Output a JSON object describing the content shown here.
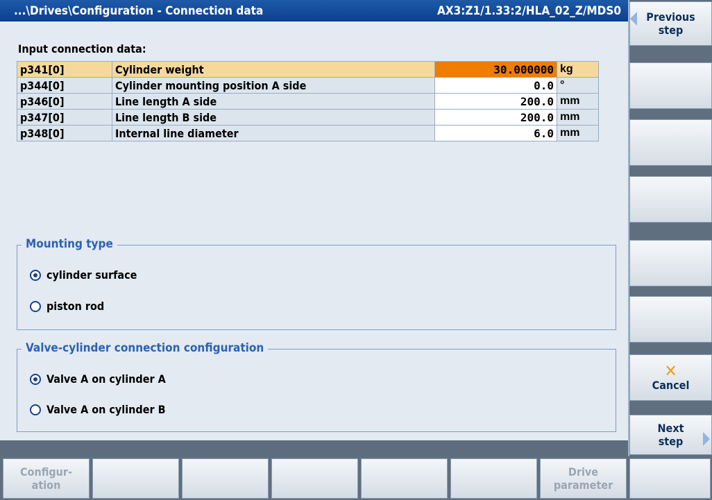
{
  "titlebar": {
    "path": "...\\Drives\\Configuration - Connection data",
    "axis": "AX3:Z1/1.33:2/HLA_02_Z/MDS0"
  },
  "section_label": "Input connection data:",
  "params": [
    {
      "id": "p341[0]",
      "desc": "Cylinder weight",
      "value": "30.000000",
      "unit": "kg",
      "selected": true
    },
    {
      "id": "p344[0]",
      "desc": "Cylinder mounting position A side",
      "value": "0.0",
      "unit": "°",
      "selected": false
    },
    {
      "id": "p346[0]",
      "desc": "Line length A side",
      "value": "200.0",
      "unit": "mm",
      "selected": false
    },
    {
      "id": "p347[0]",
      "desc": "Line length B side",
      "value": "200.0",
      "unit": "mm",
      "selected": false
    },
    {
      "id": "p348[0]",
      "desc": "Internal line diameter",
      "value": "6.0",
      "unit": "mm",
      "selected": false
    }
  ],
  "mounting_type": {
    "title": "Mounting type",
    "options": [
      {
        "label": "cylinder surface",
        "checked": true
      },
      {
        "label": "piston rod",
        "checked": false
      }
    ]
  },
  "valve_config": {
    "title": "Valve-cylinder connection configuration",
    "options": [
      {
        "label": "Valve A on cylinder A",
        "checked": true
      },
      {
        "label": "Valve A on cylinder B",
        "checked": false
      }
    ]
  },
  "vertical_softkeys": {
    "previous_step_line1": "Previous",
    "previous_step_line2": "step",
    "cancel": "Cancel",
    "next_step_line1": "Next",
    "next_step_line2": "step"
  },
  "horizontal_softkeys": {
    "configuration_line1": "Configur-",
    "configuration_line2": "ation",
    "drive_parameter_line1": "Drive",
    "drive_parameter_line2": "parameter"
  },
  "colors": {
    "title_bar": "#0a3f8e",
    "selected_value": "#ef7d00",
    "selected_row": "#f6d89c",
    "group_title": "#2c62b4",
    "cancel_icon": "#f29a1a"
  },
  "icons": {
    "previous": "arrow-left-icon",
    "next": "arrow-right-icon",
    "cancel": "cancel-x-icon"
  }
}
